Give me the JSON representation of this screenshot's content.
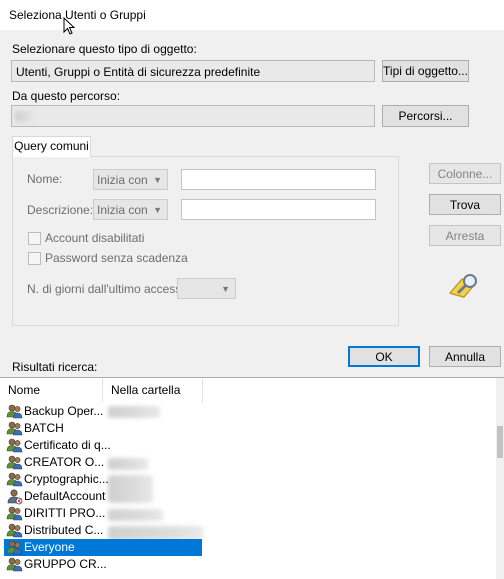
{
  "window": {
    "title": "Seleziona Utenti o Gruppi"
  },
  "object_type": {
    "label": "Selezionare questo tipo di oggetto:",
    "value": "Utenti, Gruppi o Entità di sicurezza predefinite",
    "button": "Tipi di oggetto..."
  },
  "location": {
    "label": "Da questo percorso:",
    "button": "Percorsi..."
  },
  "query": {
    "tab": "Query comuni",
    "name_label": "Nome:",
    "name_mode": "Inizia con",
    "desc_label": "Descrizione:",
    "desc_mode": "Inizia con",
    "disabled_accounts": "Account disabilitati",
    "no_expiry": "Password senza scadenza",
    "days_label": "N. di giorni dall'ultimo accesso:"
  },
  "side_buttons": {
    "columns": "Colonne...",
    "find": "Trova",
    "stop": "Arresta"
  },
  "dialog_buttons": {
    "ok": "OK",
    "cancel": "Annulla"
  },
  "results": {
    "label": "Risultati ricerca:",
    "columns": [
      "Nome",
      "Nella cartella"
    ],
    "rows": [
      {
        "name": "Backup Oper...",
        "icon": "group-icon",
        "selected": false
      },
      {
        "name": "BATCH",
        "icon": "group-icon",
        "selected": false
      },
      {
        "name": "Certificato di q...",
        "icon": "group-icon",
        "selected": false
      },
      {
        "name": "CREATOR O...",
        "icon": "group-icon",
        "selected": false
      },
      {
        "name": "Cryptographic...",
        "icon": "group-icon",
        "selected": false
      },
      {
        "name": "DefaultAccount",
        "icon": "user-icon",
        "selected": false
      },
      {
        "name": "DIRITTI PRO...",
        "icon": "group-icon",
        "selected": false
      },
      {
        "name": "Distributed C...",
        "icon": "group-icon",
        "selected": false
      },
      {
        "name": "Everyone",
        "icon": "group-icon",
        "selected": true
      },
      {
        "name": "GRUPPO CR...",
        "icon": "group-icon",
        "selected": false
      }
    ]
  },
  "colors": {
    "accent": "#0078d7",
    "background": "#f0f0f0"
  }
}
